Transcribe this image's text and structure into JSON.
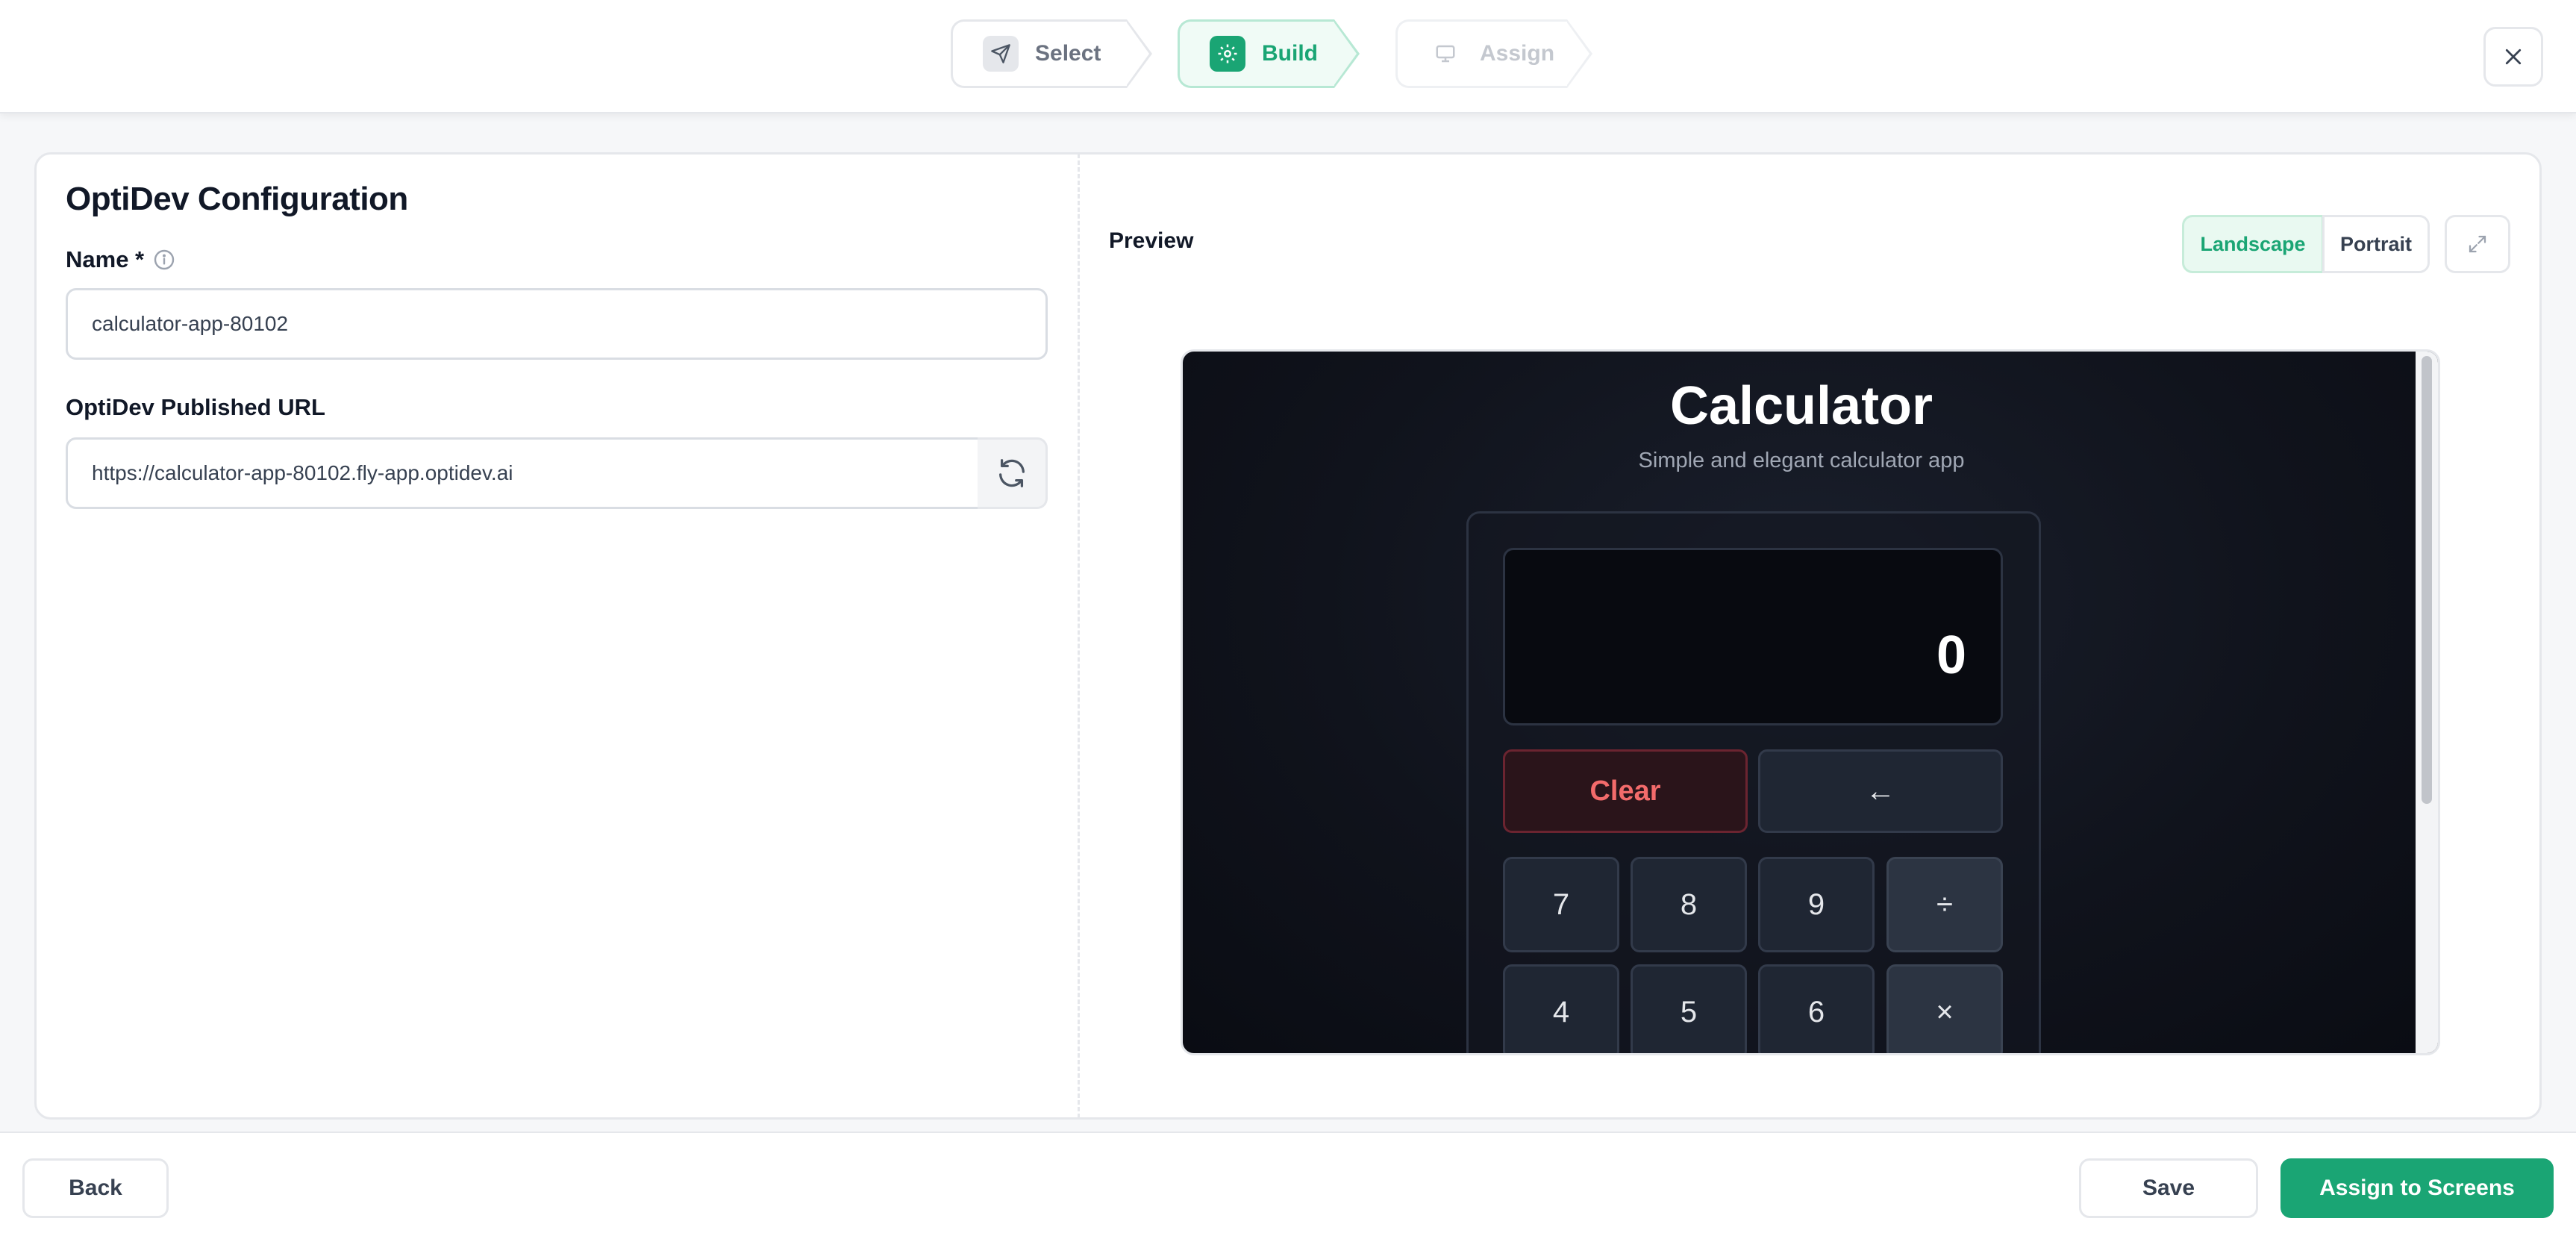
{
  "steps": {
    "select": "Select",
    "build": "Build",
    "assign": "Assign"
  },
  "config": {
    "title": "OptiDev Configuration",
    "name_label": "Name *",
    "name_value": "calculator-app-80102",
    "url_label": "OptiDev Published URL",
    "url_value": "https://calculator-app-80102.fly-app.optidev.ai"
  },
  "preview": {
    "title": "Preview",
    "landscape": "Landscape",
    "portrait": "Portrait"
  },
  "calculator": {
    "title": "Calculator",
    "subtitle": "Simple and elegant calculator app",
    "display": "0",
    "clear": "Clear",
    "backspace": "←",
    "keys": [
      "7",
      "8",
      "9",
      "÷",
      "4",
      "5",
      "6",
      "×"
    ]
  },
  "footer": {
    "back": "Back",
    "save": "Save",
    "assign": "Assign to Screens"
  },
  "colors": {
    "accent": "#1aa574",
    "danger": "#f36b6b"
  }
}
